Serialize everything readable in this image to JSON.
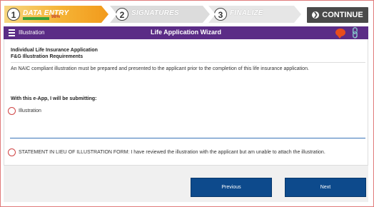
{
  "steps": [
    {
      "number": "1",
      "label": "DATA ENTRY",
      "progress_text": "98%",
      "progress": 0.98
    },
    {
      "number": "2",
      "label": "SIGNATURES"
    },
    {
      "number": "3",
      "label": "FINALIZE"
    }
  ],
  "toolbar": {
    "continue_label": "CONTINUE"
  },
  "header": {
    "section": "Illustration",
    "title": "Life Application Wizard"
  },
  "content": {
    "app_title": "Individual Life Insurance Application",
    "app_subtitle": "F&G Illustration Requirements",
    "notice": "An NAIC compliant illustration must be prepared and presented to the applicant prior to the completion of this life insurance application.",
    "submit_question": "With this e-App, I will be submitting:",
    "option_illustration": "Illustration",
    "option_statement": "STATEMENT IN LIEU OF ILLUSTRATION FORM: I have reviewed the illustration with the applicant but am unable to attach the illustration."
  },
  "footer": {
    "previous_label": "Previous",
    "next_label": "Next"
  },
  "colors": {
    "header": "#5b2c86",
    "accent_button": "#0d4a8c",
    "step_active": "#f5b335",
    "radio_border": "#d04545"
  }
}
